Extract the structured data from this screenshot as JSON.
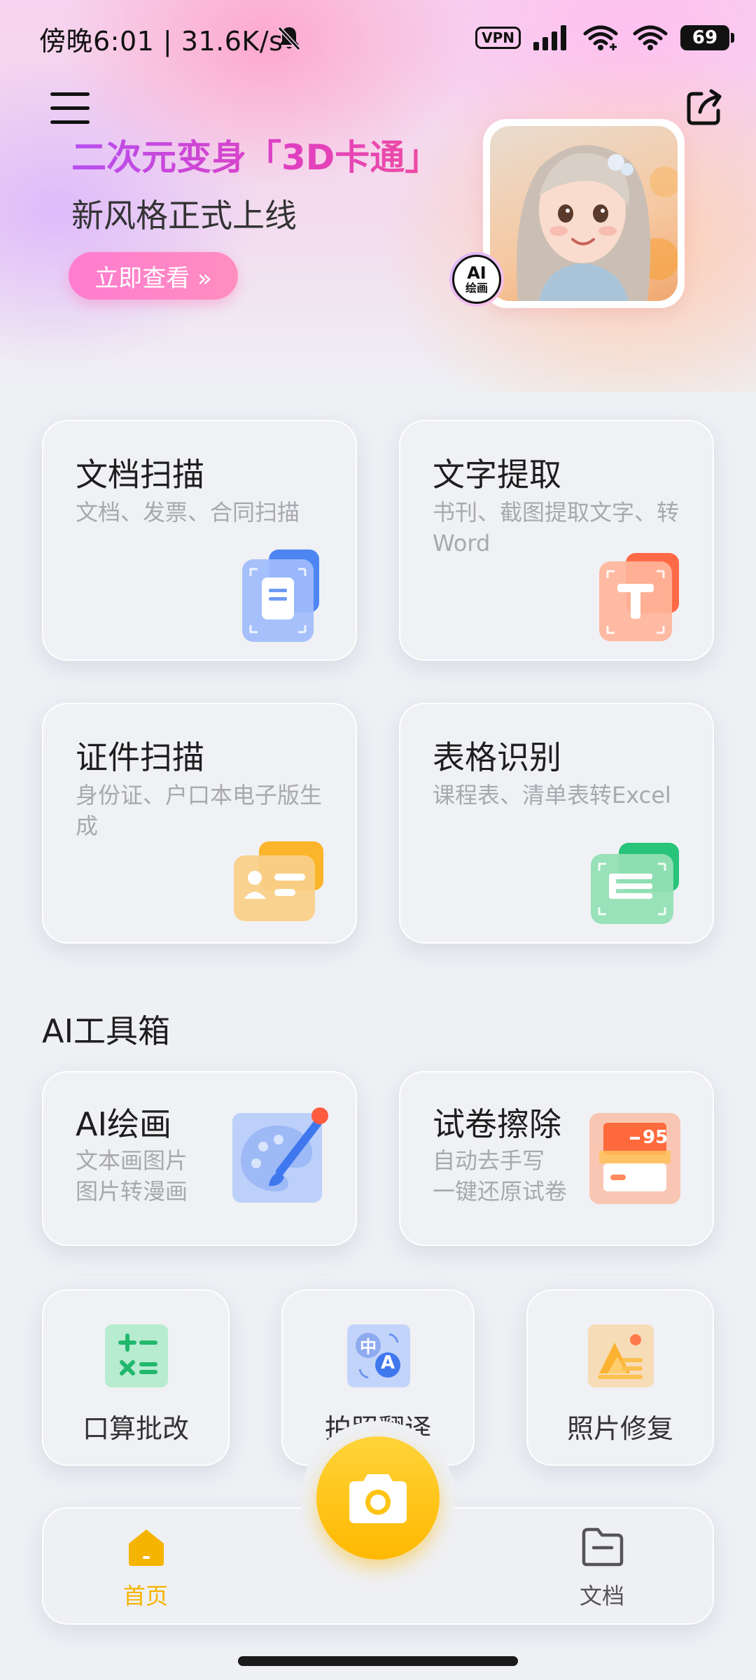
{
  "status_bar": {
    "time_speed": "傍晚6:01 | 31.6K/s",
    "vpn": "VPN",
    "battery": "69"
  },
  "banner": {
    "title": "二次元变身「3D卡通」",
    "subtitle": "新风格正式上线",
    "cta": "立即查看 »",
    "badge_line1": "AI",
    "badge_line2": "绘画"
  },
  "features": [
    {
      "title": "文档扫描",
      "desc": "文档、发票、合同扫描",
      "icon": "document-scan-icon",
      "color": "#5b8df5"
    },
    {
      "title": "文字提取",
      "desc": "书刊、截图提取文字、转Word",
      "icon": "text-extract-icon",
      "color": "#ff6d4a"
    },
    {
      "title": "证件扫描",
      "desc": "身份证、户口本电子版生成",
      "icon": "id-card-scan-icon",
      "color": "#f7b62c"
    },
    {
      "title": "表格识别",
      "desc": "课程表、清单表转Excel",
      "icon": "table-recognition-icon",
      "color": "#2dc77a"
    }
  ],
  "ai_toolbox": {
    "heading": "AI工具箱",
    "tools": [
      {
        "title": "AI绘画",
        "desc_line1": "文本画图片",
        "desc_line2": "图片转漫画",
        "icon": "paintbrush-palette-icon"
      },
      {
        "title": "试卷擦除",
        "desc_line1": "自动去手写",
        "desc_line2": "一键还原试卷",
        "icon": "exam-erase-icon",
        "score": "95"
      }
    ],
    "small_tools": [
      {
        "label": "口算批改",
        "icon": "math-check-icon"
      },
      {
        "label": "拍照翻译",
        "icon": "photo-translate-icon",
        "glyph_zh": "中",
        "glyph_en": "A"
      },
      {
        "label": "照片修复",
        "icon": "photo-restore-icon"
      }
    ]
  },
  "bottom_nav": {
    "home": "首页",
    "docs": "文档",
    "accent": "#f5b400"
  }
}
